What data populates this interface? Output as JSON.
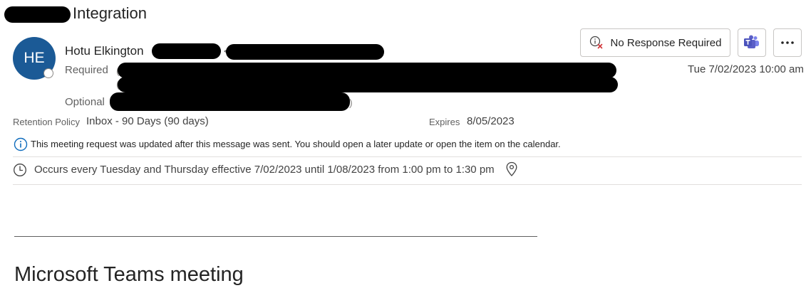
{
  "subject": {
    "title_suffix": "Integration"
  },
  "sender": {
    "initials": "HE",
    "name": "Hotu Elkington",
    "angle_bracket": "<"
  },
  "recipients": {
    "required_label": "Required",
    "optional_label": "Optional",
    "required_open_1": "(",
    "required_open_2": "(",
    "optional_close": ")"
  },
  "toolbar": {
    "no_response_label": "No Response Required",
    "teams_icon": "teams-icon",
    "more_icon": "more-icon"
  },
  "sent_date": "Tue 7/02/2023 10:00 am",
  "retention": {
    "label": "Retention Policy",
    "value": "Inbox - 90 Days (90 days)",
    "expires_label": "Expires",
    "expires_value": "8/05/2023"
  },
  "info_bar": {
    "text": "This meeting request was updated after this message was sent. You should open a later update or open the item on the calendar."
  },
  "recurrence": {
    "text": "Occurs every Tuesday and Thursday effective 7/02/2023 until 1/08/2023 from 1:00 pm to 1:30 pm"
  },
  "body": {
    "heading": "Microsoft Teams meeting"
  },
  "colors": {
    "avatar": "#1b5a96",
    "info_accent": "#0f6cbd",
    "teams_purple": "#5b5fc7",
    "decline_red": "#d13438"
  }
}
